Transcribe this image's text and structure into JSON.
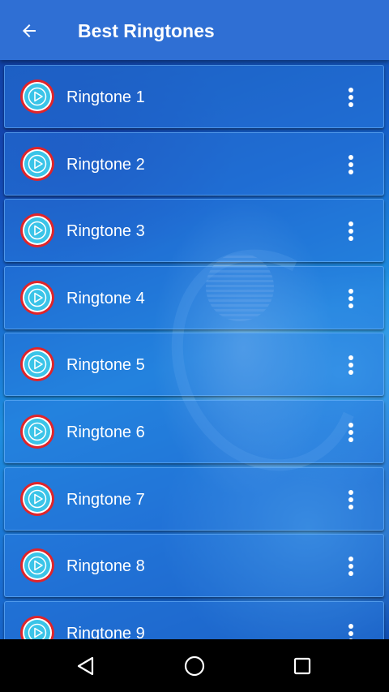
{
  "app_bar": {
    "title": "Best Ringtones",
    "back_icon": "arrow-back-icon",
    "background_color": "#2f6fd4"
  },
  "ringtones": [
    {
      "label": "Ringtone 1"
    },
    {
      "label": "Ringtone 2"
    },
    {
      "label": "Ringtone 3"
    },
    {
      "label": "Ringtone 4"
    },
    {
      "label": "Ringtone 5"
    },
    {
      "label": "Ringtone 6"
    },
    {
      "label": "Ringtone 7"
    },
    {
      "label": "Ringtone 8"
    },
    {
      "label": "Ringtone 9"
    }
  ],
  "row_icons": {
    "play": "play-disc-icon",
    "menu": "more-vert-icon"
  },
  "nav_bar": {
    "back": "nav-back-icon",
    "home": "nav-home-icon",
    "recents": "nav-recents-icon"
  },
  "colors": {
    "disc_ring_red": "#e0242a",
    "disc_fill": "#3bc4e8",
    "text": "#ffffff"
  }
}
